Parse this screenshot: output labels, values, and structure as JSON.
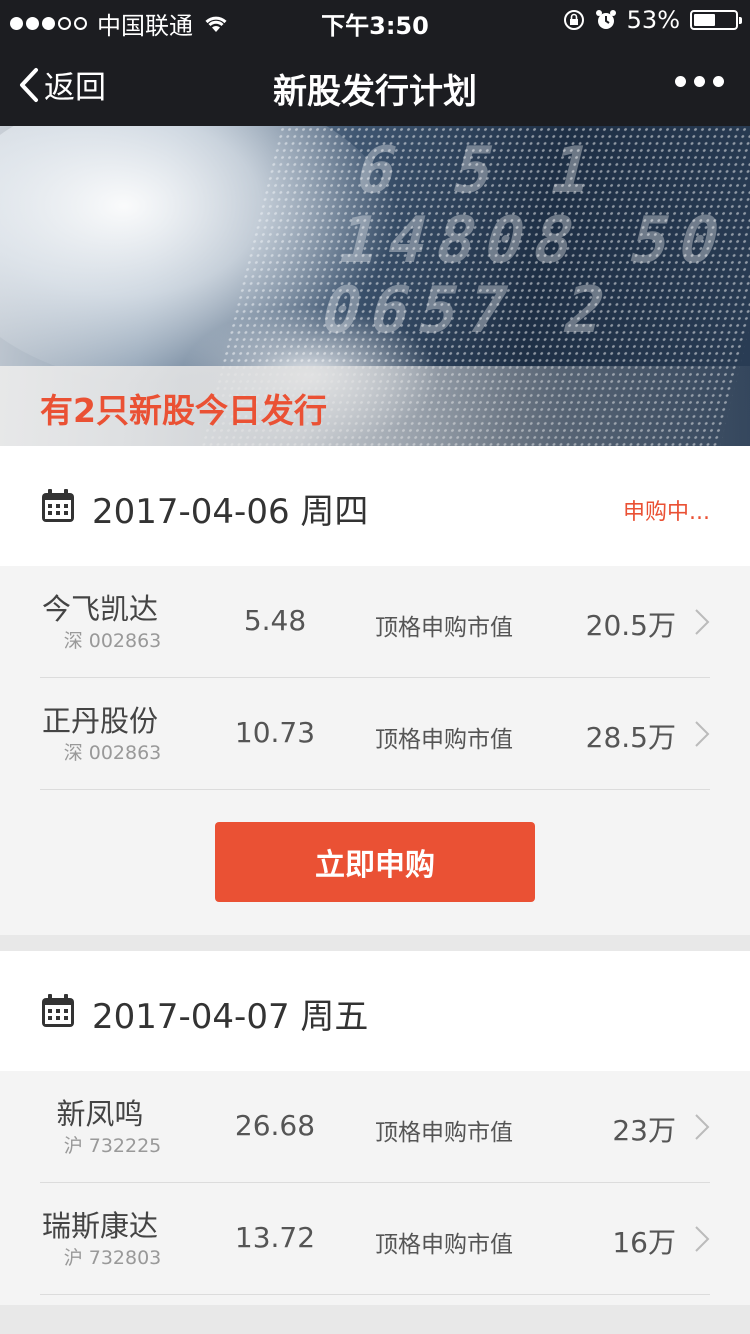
{
  "status_bar": {
    "carrier": "中国联通",
    "time": "下午3:50",
    "battery": "53%",
    "battery_level": 0.53
  },
  "nav": {
    "back_label": "返回",
    "title": "新股发行计划"
  },
  "banner": {
    "headline": "有2只新股今日发行",
    "digits": [
      "6 5 1",
      "14808 50",
      "0657 2"
    ]
  },
  "sections": [
    {
      "date": "2017-04-06  周四",
      "status": "申购中...",
      "rows": [
        {
          "name": "今飞凯达",
          "code": "深 002863",
          "price": "5.48",
          "label": "顶格申购市值",
          "value": "20.5万"
        },
        {
          "name": "正丹股份",
          "code": "深 002863",
          "price": "10.73",
          "label": "顶格申购市值",
          "value": "28.5万"
        }
      ],
      "button": "立即申购"
    },
    {
      "date": "2017-04-07 周五",
      "rows": [
        {
          "name": "新凤鸣",
          "code": "沪 732225",
          "price": "26.68",
          "label": "顶格申购市值",
          "value": "23万"
        },
        {
          "name": "瑞斯康达",
          "code": "沪 732803",
          "price": "13.72",
          "label": "顶格申购市值",
          "value": "16万"
        }
      ]
    }
  ],
  "colors": {
    "accent": "#ea5134",
    "navbar": "#1c1d21"
  }
}
